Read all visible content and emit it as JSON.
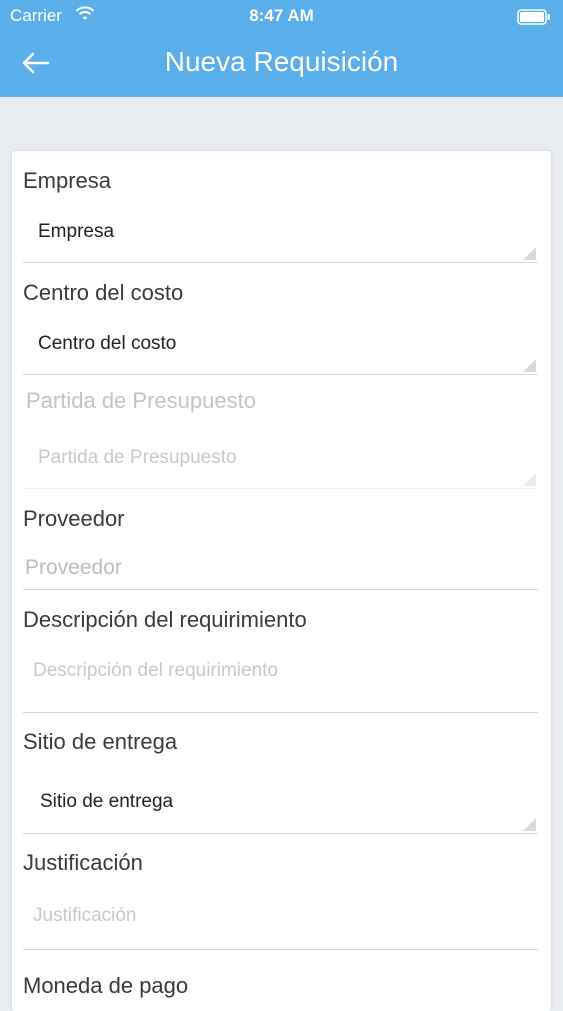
{
  "status_bar": {
    "carrier": "Carrier",
    "time": "8:47 AM"
  },
  "header": {
    "title": "Nueva Requisición"
  },
  "form": {
    "empresa": {
      "label": "Empresa",
      "value": "Empresa"
    },
    "centro_costo": {
      "label": "Centro del costo",
      "value": "Centro del costo"
    },
    "partida": {
      "label": "Partida de Presupuesto",
      "placeholder": "Partida de Presupuesto"
    },
    "proveedor": {
      "label": "Proveedor",
      "placeholder": "Proveedor"
    },
    "descripcion": {
      "label": "Descripción del requirimiento",
      "placeholder": "Descripción del requirimiento"
    },
    "sitio": {
      "label": "Sitio de entrega",
      "value": "Sitio de entrega"
    },
    "justificacion": {
      "label": "Justificación",
      "placeholder": "Justificación"
    },
    "moneda": {
      "label": "Moneda de pago"
    }
  },
  "colors": {
    "header": "#5aaeea",
    "background": "#e9edf2",
    "card": "#ffffff"
  }
}
